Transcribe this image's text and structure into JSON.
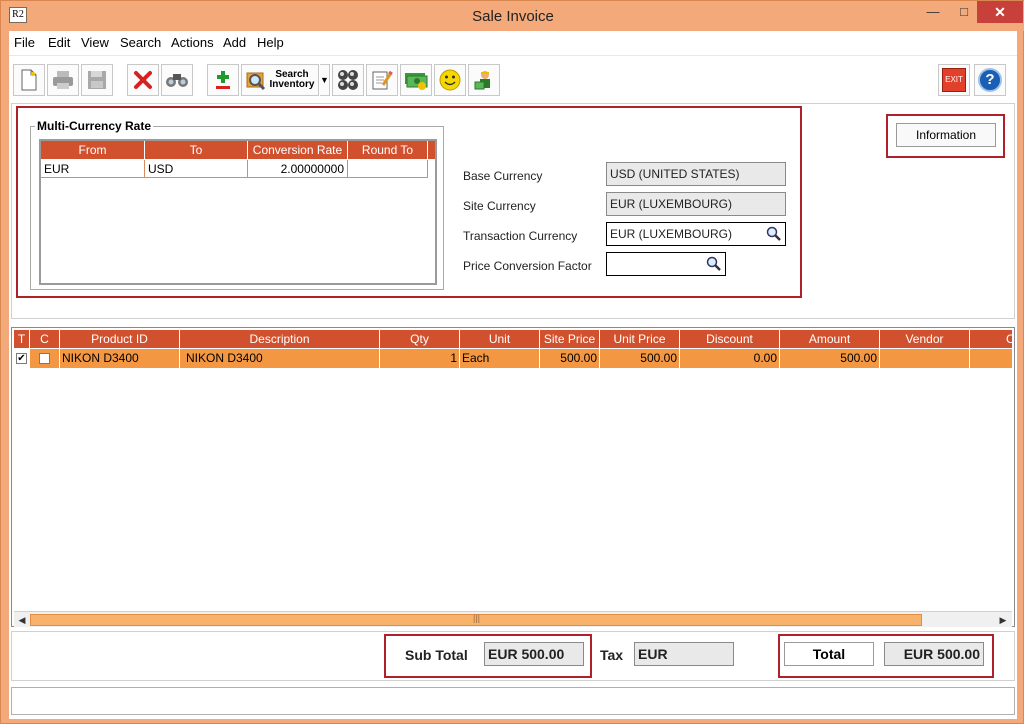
{
  "window": {
    "title": "Sale Invoice",
    "app_icon_text": "R2"
  },
  "menu": [
    {
      "label": "File"
    },
    {
      "label": "Edit"
    },
    {
      "label": "View"
    },
    {
      "label": "Search"
    },
    {
      "label": "Actions"
    },
    {
      "label": "Add"
    },
    {
      "label": "Help"
    }
  ],
  "toolbar": {
    "search_inventory_line1": "Search",
    "search_inventory_line2": "Inventory",
    "exit_label": "EXIT",
    "help_label": "?"
  },
  "multi_currency": {
    "legend": "Multi-Currency Rate",
    "columns": [
      "From",
      "To",
      "Conversion Rate",
      "Round To"
    ],
    "rows": [
      {
        "from": "EUR",
        "to": "USD",
        "rate": "2.00000000",
        "round_to": ""
      }
    ]
  },
  "currency_fields": {
    "base_currency_label": "Base Currency",
    "base_currency_value": "USD (UNITED STATES)",
    "site_currency_label": "Site Currency",
    "site_currency_value": "EUR (LUXEMBOURG)",
    "transaction_currency_label": "Transaction Currency",
    "transaction_currency_value": "EUR (LUXEMBOURG)",
    "price_conversion_factor_label": "Price Conversion Factor",
    "price_conversion_factor_value": ""
  },
  "information_button": "Information",
  "grid": {
    "columns": [
      "T",
      "C",
      "Product ID",
      "Description",
      "Qty",
      "Unit",
      "Site Price",
      "Unit Price",
      "Discount",
      "Amount",
      "Vendor",
      "C"
    ],
    "rows": [
      {
        "t_checked": "✔",
        "c_checked": "",
        "product_id": "NIKON D3400",
        "description": "NIKON D3400",
        "qty": "1",
        "unit": "Each",
        "site_price": "500.00",
        "unit_price": "500.00",
        "discount": "0.00",
        "amount": "500.00",
        "vendor": ""
      }
    ],
    "scroll_mid": "|||"
  },
  "totals": {
    "sub_total_label": "Sub Total",
    "sub_total_value": "EUR 500.00",
    "tax_label": "Tax",
    "tax_value": "EUR",
    "total_label": "Total",
    "total_value": "EUR 500.00"
  },
  "colors": {
    "header": "#d1502e",
    "row_highlight": "#f49742",
    "window_frame": "#f4a97a",
    "annotation_red": "#b0202a"
  }
}
